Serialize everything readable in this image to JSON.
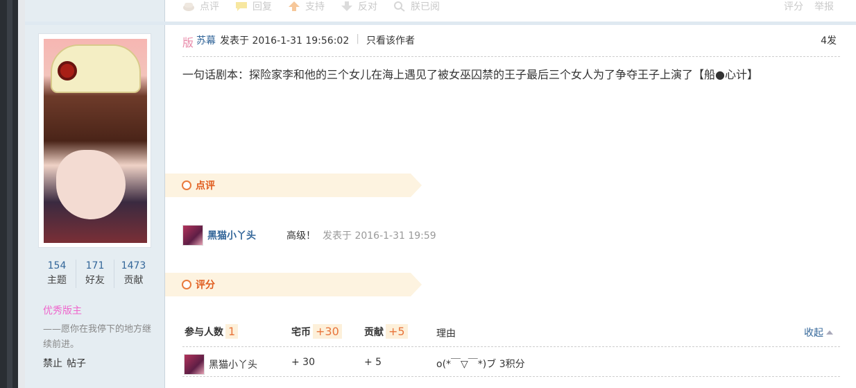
{
  "toolbar": {
    "items": [
      {
        "label": "点评",
        "icon": "comment-cup-icon"
      },
      {
        "label": "回复",
        "icon": "speech-bubble-icon"
      },
      {
        "label": "支持",
        "icon": "arrow-up-icon"
      },
      {
        "label": "反对",
        "icon": "arrow-down-icon"
      },
      {
        "label": "朕已阅",
        "icon": "magnifier-icon"
      }
    ],
    "right": [
      "评分",
      "举报"
    ]
  },
  "profile": {
    "stats": [
      {
        "value": "154",
        "label": "主题"
      },
      {
        "value": "171",
        "label": "好友"
      },
      {
        "value": "1473",
        "label": "贡献"
      }
    ],
    "title_badge": "优秀版主",
    "signature": "——愿你在我停下的地方继续前进。",
    "admin_links": [
      "禁止",
      "帖子"
    ]
  },
  "post": {
    "mod_badge": "版",
    "author": "苏幕",
    "posted": "发表于 2016-1-31 19:56:02",
    "only_author": "只看该作者",
    "floor": "4发",
    "body": "一句话剧本：探险家李和他的三个女儿在海上遇见了被女巫囚禁的王子最后三个女人为了争夺王子上演了【船●心计】"
  },
  "comments_section": {
    "title": "点评",
    "items": [
      {
        "user": "黑猫小丫头",
        "text": "高级！",
        "time": "发表于 2016-1-31 19:59"
      }
    ]
  },
  "rating_section": {
    "title": "评分",
    "participants_label": "参与人数",
    "participants": "1",
    "coin_label": "宅币",
    "coin_total": "+30",
    "contrib_label": "贡献",
    "contrib_total": "+5",
    "reason_label": "理由",
    "collapse_label": "收起",
    "rows": [
      {
        "user": "黑猫小丫头",
        "coin": "+ 30",
        "contrib": "+ 5",
        "reason": "o(*￣▽￣*)ブ 3积分"
      }
    ]
  },
  "colors": {
    "link_blue": "#336699",
    "accent_orange": "#e05c1e",
    "badge_pink": "#ee66cc",
    "sidebar_bg": "#e5edf2",
    "section_bg": "#fdf3e0"
  }
}
